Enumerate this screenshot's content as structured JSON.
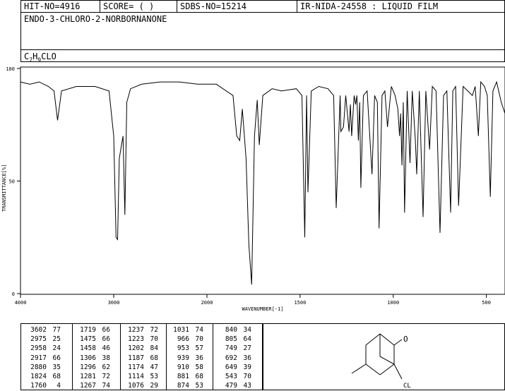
{
  "header": {
    "hit": "HIT-NO=4916",
    "score": "SCORE=  (   )",
    "sdbs": "SDBS-NO=15214",
    "ir": "IR-NIDA-24558 : LIQUID FILM"
  },
  "compound_name": "ENDO-3-CHLORO-2-NORBORNANONE",
  "formula": {
    "c": "C",
    "c_sub": "7",
    "h": "H",
    "h_sub": "9",
    "rest": "CLO"
  },
  "structure_label": "CL",
  "chart_data": {
    "type": "line",
    "xlabel": "WAVENUMBER[-1]",
    "ylabel": "TRANSMITTANCE[%]",
    "xlim": [
      4000,
      400
    ],
    "ylim": [
      0,
      100
    ],
    "x_ticks": [
      4000,
      3000,
      2000,
      1500,
      1000,
      500
    ],
    "y_ticks": [
      0,
      50,
      100
    ],
    "series": [
      {
        "x": [
          4000,
          3900,
          3800,
          3700,
          3640,
          3602,
          3560,
          3400,
          3200,
          3050,
          3000,
          2975,
          2958,
          2940,
          2917,
          2900,
          2880,
          2860,
          2820,
          2700,
          2500,
          2300,
          2100,
          1950,
          1860,
          1840,
          1824,
          1810,
          1790,
          1775,
          1760,
          1745,
          1730,
          1719,
          1700,
          1650,
          1600,
          1520,
          1490,
          1475,
          1465,
          1458,
          1440,
          1400,
          1350,
          1320,
          1306,
          1296,
          1285,
          1281,
          1267,
          1255,
          1237,
          1230,
          1223,
          1210,
          1202,
          1195,
          1187,
          1180,
          1174,
          1160,
          1140,
          1114,
          1100,
          1085,
          1076,
          1060,
          1045,
          1031,
          1010,
          990,
          975,
          966,
          960,
          953,
          946,
          939,
          925,
          910,
          898,
          881,
          874,
          860,
          840,
          825,
          805,
          790,
          770,
          749,
          730,
          712,
          692,
          680,
          665,
          649,
          625,
          600,
          575,
          560,
          543,
          530,
          510,
          495,
          479,
          465,
          445,
          420,
          400
        ],
        "y": [
          94,
          93,
          94,
          92,
          90,
          77,
          90,
          92,
          92,
          90,
          70,
          25,
          24,
          60,
          66,
          70,
          35,
          85,
          91,
          93,
          94,
          94,
          93,
          93,
          88,
          70,
          68,
          82,
          60,
          22,
          4,
          70,
          86,
          66,
          88,
          91,
          90,
          91,
          88,
          25,
          88,
          45,
          90,
          92,
          91,
          88,
          38,
          62,
          88,
          72,
          74,
          88,
          72,
          84,
          70,
          88,
          84,
          88,
          68,
          85,
          47,
          88,
          90,
          53,
          88,
          85,
          29,
          88,
          90,
          74,
          92,
          88,
          82,
          70,
          80,
          57,
          85,
          36,
          90,
          58,
          90,
          68,
          53,
          90,
          34,
          90,
          64,
          92,
          90,
          27,
          88,
          90,
          36,
          90,
          92,
          39,
          92,
          90,
          88,
          92,
          70,
          94,
          92,
          88,
          43,
          90,
          94,
          85,
          80
        ]
      }
    ]
  },
  "peak_table": {
    "columns": [
      [
        [
          "3602",
          "77"
        ],
        [
          "2975",
          "25"
        ],
        [
          "2958",
          "24"
        ],
        [
          "2917",
          "66"
        ],
        [
          "2880",
          "35"
        ],
        [
          "1824",
          "68"
        ],
        [
          "1760",
          "4"
        ]
      ],
      [
        [
          "1719",
          "66"
        ],
        [
          "1475",
          "66"
        ],
        [
          "1458",
          "46"
        ],
        [
          "1306",
          "38"
        ],
        [
          "1296",
          "62"
        ],
        [
          "1281",
          "72"
        ],
        [
          "1267",
          "74"
        ]
      ],
      [
        [
          "1237",
          "72"
        ],
        [
          "1223",
          "70"
        ],
        [
          "1202",
          "84"
        ],
        [
          "1187",
          "68"
        ],
        [
          "1174",
          "47"
        ],
        [
          "1114",
          "53"
        ],
        [
          "1076",
          "29"
        ]
      ],
      [
        [
          "1031",
          "74"
        ],
        [
          "966",
          "70"
        ],
        [
          "953",
          "57"
        ],
        [
          "939",
          "36"
        ],
        [
          "910",
          "58"
        ],
        [
          "881",
          "68"
        ],
        [
          "874",
          "53"
        ]
      ],
      [
        [
          "840",
          "34"
        ],
        [
          "805",
          "64"
        ],
        [
          "749",
          "27"
        ],
        [
          "692",
          "36"
        ],
        [
          "649",
          "39"
        ],
        [
          "543",
          "70"
        ],
        [
          "479",
          "43"
        ]
      ]
    ]
  }
}
